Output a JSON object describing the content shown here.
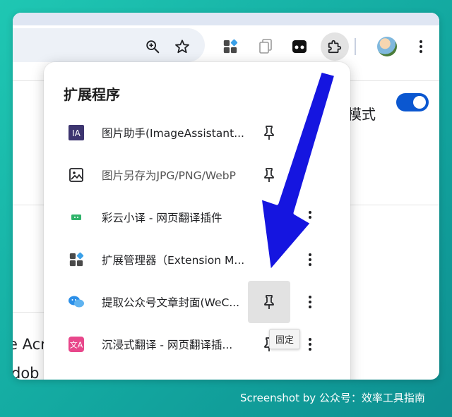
{
  "toolbar": {
    "icons": [
      "zoom-icon",
      "bookmark-star-icon",
      "extension-manager-icon",
      "copy-icon",
      "tab-icon",
      "extensions-puzzle-icon",
      "profile-avatar",
      "more-vert-icon"
    ]
  },
  "background_page": {
    "mode_label": "模式",
    "toggle_on": true,
    "partial_text_1": "e Acr",
    "partial_text_2": "dob"
  },
  "extensions_panel": {
    "title": "扩展程序",
    "items": [
      {
        "label": "图片助手(ImageAssistant...",
        "icon": "image-assistant-icon",
        "pinned": false
      },
      {
        "label": "图片另存为JPG/PNG/WebP",
        "icon": "image-icon",
        "pinned": false
      },
      {
        "label": "彩云小译 - 网页翻译插件",
        "icon": "caiyun-translate-icon",
        "pinned": false
      },
      {
        "label": "扩展管理器（Extension M...",
        "icon": "extension-manager-icon",
        "pinned": false
      },
      {
        "label": "提取公众号文章封面(WeC...",
        "icon": "wechat-icon",
        "pinned": false,
        "hover": true
      },
      {
        "label": "沉浸式翻译 - 网页翻译插...",
        "icon": "immersive-translate-icon",
        "pinned": false
      }
    ],
    "tooltip": "固定"
  },
  "caption": "Screenshot by 公众号：效率工具指南",
  "colors": {
    "accent_blue": "#0b57d0",
    "arrow_blue": "#1515e0",
    "background_teal": "#13a8a0"
  }
}
